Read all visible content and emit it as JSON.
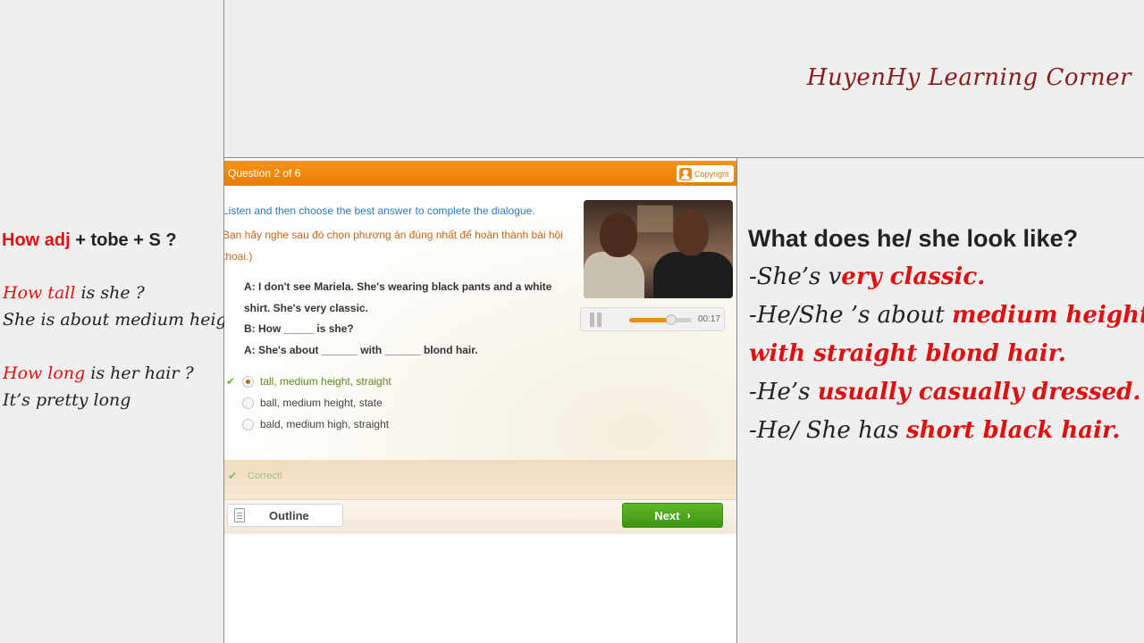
{
  "brand": "HuyenHy Learning Corner",
  "left_notes": {
    "formula": {
      "how_adj": "How adj",
      "rest": " + tobe  + S ?"
    },
    "q1": {
      "red": "How tall",
      "rest": " is she ?"
    },
    "a1": "She is about medium height",
    "q2": {
      "red": "How long",
      "rest": "  is  her hair ?"
    },
    "a2": "It’s  pretty long"
  },
  "right_notes": {
    "title": "What does he/ she  look like?",
    "lines": [
      {
        "prefix": "-She’s v",
        "red": "ery classic.",
        "suffix": ""
      },
      {
        "prefix": "-He/She ’s about ",
        "red": "medium height",
        "suffix": ""
      },
      {
        "prefix": "",
        "red": "with straight blond hair.",
        "suffix": ""
      },
      {
        "prefix": "-He’s ",
        "red": "usually casually dressed.",
        "suffix": ""
      },
      {
        "prefix": "-He/ She  has ",
        "red": "short black hair.",
        "suffix": ""
      }
    ]
  },
  "quiz": {
    "question_counter": "Question 2 of 6",
    "copyright": "Copyright",
    "instruction_en": "Listen and then choose the best answer to complete the dialogue.",
    "instruction_vi": "Bạn hãy nghe sau đó chọn phương án đúng nhất để hoàn thành bài hội thoại.)",
    "dialogue": [
      "A: I don't see Mariela. She's wearing black pants and a white shirt. She's very classic.",
      "B: How _____ is she?",
      "A: She's about ______ with ______ blond hair."
    ],
    "options": [
      {
        "label": "tall, medium height, straight",
        "selected": true
      },
      {
        "label": "ball, medium height, state",
        "selected": false
      },
      {
        "label": "bald, medium high, straight",
        "selected": false
      }
    ],
    "audio": {
      "time": "00:17",
      "progress": 0.67
    },
    "feedback": "Correct!",
    "outline_label": "Outline",
    "next_label": "Next"
  }
}
